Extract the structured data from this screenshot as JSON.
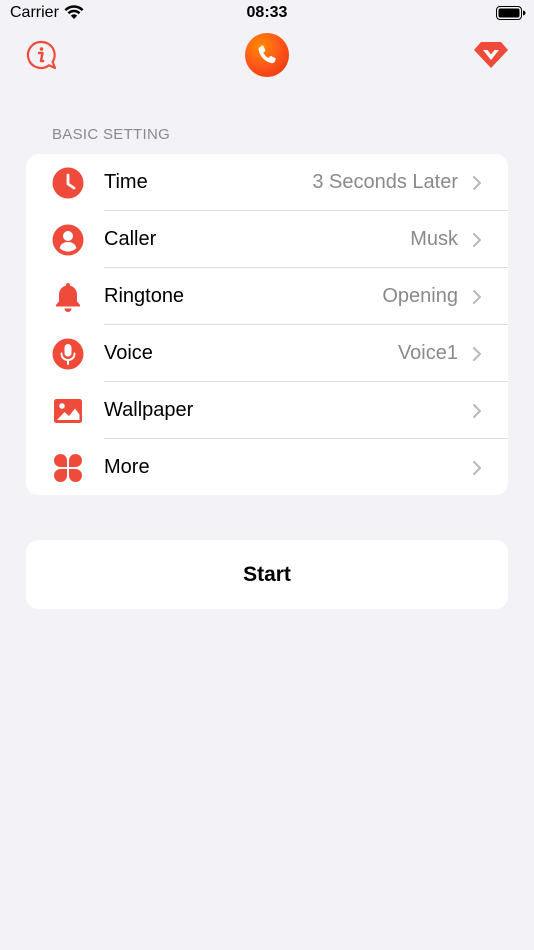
{
  "status_bar": {
    "carrier": "Carrier",
    "time": "08:33"
  },
  "nav": {
    "left_icon": "info-bubble-icon",
    "center_icon": "phone-logo-icon",
    "right_icon": "diamond-icon"
  },
  "section_title": "BASIC SETTING",
  "settings": [
    {
      "label": "Time",
      "value": "3 Seconds Later",
      "icon": "clock-icon"
    },
    {
      "label": "Caller",
      "value": "Musk",
      "icon": "person-icon"
    },
    {
      "label": "Ringtone",
      "value": "Opening",
      "icon": "bell-icon"
    },
    {
      "label": "Voice",
      "value": "Voice1",
      "icon": "microphone-icon"
    },
    {
      "label": "Wallpaper",
      "value": "",
      "icon": "image-icon"
    },
    {
      "label": "More",
      "value": "",
      "icon": "grid-icon"
    }
  ],
  "start_label": "Start",
  "colors": {
    "accent": "#f04a3a",
    "background": "#f2f2f7",
    "secondary_text": "#8a8a8e"
  }
}
